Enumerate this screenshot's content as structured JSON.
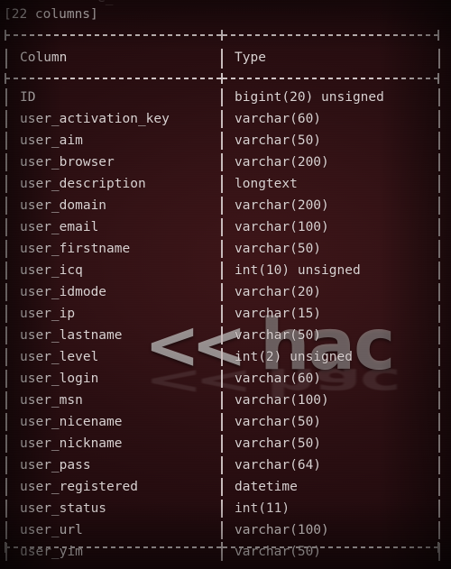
{
  "terminal": {
    "ghost_top_line": "e_",
    "summary_line": "[22 columns]",
    "border_top": "+------------------------+-----------------------+",
    "border_header": "+------------------------+-----------------------+",
    "border_bottom": "+------------------------+-----------------------+",
    "column_separator": "|",
    "colors": {
      "background": "#2a0e11",
      "text": "#dcd2d2",
      "border": "#cfc4c4",
      "watermark": "#d0cdcd"
    },
    "watermark": {
      "chevrons": "<<",
      "word": "hac"
    }
  },
  "table": {
    "headers": [
      "Column",
      "Type"
    ],
    "row_count": 22,
    "rows": [
      {
        "column": "ID",
        "type": "bigint(20) unsigned"
      },
      {
        "column": "user_activation_key",
        "type": "varchar(60)"
      },
      {
        "column": "user_aim",
        "type": "varchar(50)"
      },
      {
        "column": "user_browser",
        "type": "varchar(200)"
      },
      {
        "column": "user_description",
        "type": "longtext"
      },
      {
        "column": "user_domain",
        "type": "varchar(200)"
      },
      {
        "column": "user_email",
        "type": "varchar(100)"
      },
      {
        "column": "user_firstname",
        "type": "varchar(50)"
      },
      {
        "column": "user_icq",
        "type": "int(10) unsigned"
      },
      {
        "column": "user_idmode",
        "type": "varchar(20)"
      },
      {
        "column": "user_ip",
        "type": "varchar(15)"
      },
      {
        "column": "user_lastname",
        "type": "varchar(50)"
      },
      {
        "column": "user_level",
        "type": "int(2) unsigned"
      },
      {
        "column": "user_login",
        "type": "varchar(60)"
      },
      {
        "column": "user_msn",
        "type": "varchar(100)"
      },
      {
        "column": "user_nicename",
        "type": "varchar(50)"
      },
      {
        "column": "user_nickname",
        "type": "varchar(50)"
      },
      {
        "column": "user_pass",
        "type": "varchar(64)"
      },
      {
        "column": "user_registered",
        "type": "datetime"
      },
      {
        "column": "user_status",
        "type": "int(11)"
      },
      {
        "column": "user_url",
        "type": "varchar(100)"
      },
      {
        "column": "user_yim",
        "type": "varchar(50)"
      }
    ]
  }
}
